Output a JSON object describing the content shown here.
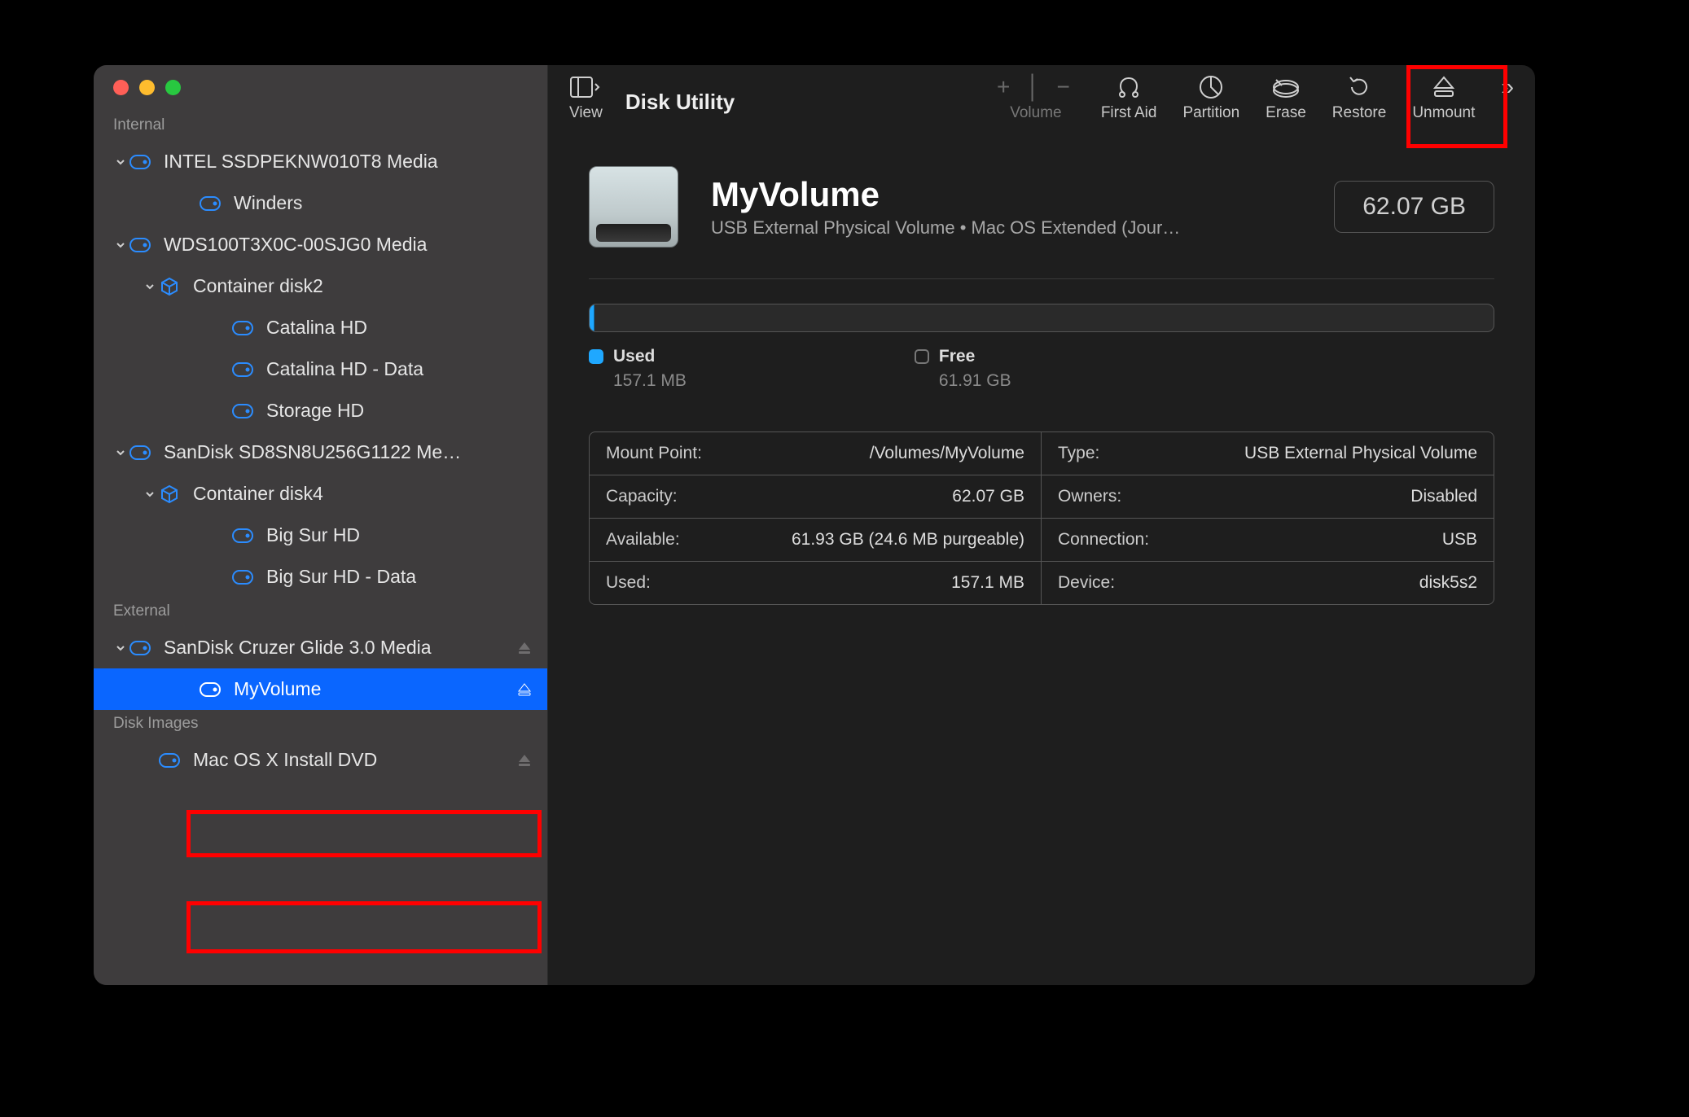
{
  "app_title": "Disk Utility",
  "traffic": {
    "close": "close",
    "min": "min",
    "max": "max"
  },
  "toolbar": {
    "view": "View",
    "volume": "Volume",
    "first_aid": "First Aid",
    "partition": "Partition",
    "erase": "Erase",
    "restore": "Restore",
    "unmount": "Unmount"
  },
  "sidebar": {
    "sections": {
      "internal": "Internal",
      "external": "External",
      "disk_images": "Disk Images"
    },
    "internal": [
      {
        "label": "INTEL SSDPEKNW010T8 Media",
        "icon": "disk",
        "chev": true,
        "indent": 0
      },
      {
        "label": "Winders",
        "icon": "disk",
        "indent": 2
      },
      {
        "label": "WDS100T3X0C-00SJG0 Media",
        "icon": "disk",
        "chev": true,
        "indent": 0
      },
      {
        "label": "Container disk2",
        "icon": "container",
        "chev": true,
        "indent": 1
      },
      {
        "label": "Catalina HD",
        "icon": "disk",
        "indent": 3
      },
      {
        "label": "Catalina HD - Data",
        "icon": "disk",
        "indent": 3
      },
      {
        "label": "Storage HD",
        "icon": "disk",
        "indent": 3
      },
      {
        "label": "SanDisk SD8SN8U256G1122 Me…",
        "icon": "disk",
        "chev": true,
        "indent": 0
      },
      {
        "label": "Container disk4",
        "icon": "container",
        "chev": true,
        "indent": 1
      },
      {
        "label": "Big Sur HD",
        "icon": "disk",
        "indent": 3
      },
      {
        "label": "Big Sur HD - Data",
        "icon": "disk",
        "indent": 3
      }
    ],
    "external": [
      {
        "label": "SanDisk Cruzer Glide 3.0 Media",
        "icon": "disk",
        "chev": true,
        "indent": 0,
        "eject": true
      },
      {
        "label": "MyVolume",
        "icon": "disk",
        "indent": 2,
        "selected": true,
        "eject": true
      }
    ],
    "disk_images": [
      {
        "label": "Mac OS X Install DVD",
        "icon": "disk",
        "indent": 1,
        "eject": true
      }
    ]
  },
  "volume": {
    "name": "MyVolume",
    "subtitle": "USB External Physical Volume • Mac OS Extended (Jour…",
    "size": "62.07 GB"
  },
  "usage": {
    "used_label": "Used",
    "used_value": "157.1 MB",
    "free_label": "Free",
    "free_value": "61.91 GB"
  },
  "info_left": [
    {
      "k": "Mount Point:",
      "v": "/Volumes/MyVolume"
    },
    {
      "k": "Capacity:",
      "v": "62.07 GB"
    },
    {
      "k": "Available:",
      "v": "61.93 GB (24.6 MB purgeable)"
    },
    {
      "k": "Used:",
      "v": "157.1 MB"
    }
  ],
  "info_right": [
    {
      "k": "Type:",
      "v": "USB External Physical Volume"
    },
    {
      "k": "Owners:",
      "v": "Disabled"
    },
    {
      "k": "Connection:",
      "v": "USB"
    },
    {
      "k": "Device:",
      "v": "disk5s2"
    }
  ]
}
